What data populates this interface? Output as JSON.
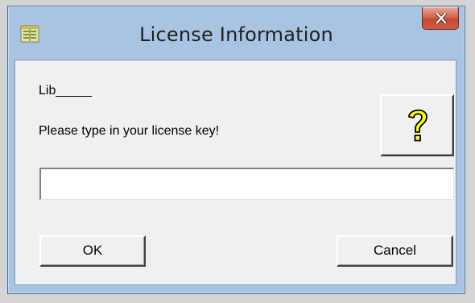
{
  "window": {
    "title": "License Information",
    "icon": "app-icon",
    "close_icon": "close-icon"
  },
  "dialog": {
    "lib_label": "Lib_____",
    "prompt": "Please type in your license key!",
    "help_icon": "question-mark-icon",
    "license_input_value": "",
    "ok_label": "OK",
    "cancel_label": "Cancel"
  },
  "colors": {
    "frame": "#a9c3e2",
    "client_bg": "#f0f0f0",
    "close_button": "#c44a36",
    "help_icon_fill": "#ffff00"
  }
}
